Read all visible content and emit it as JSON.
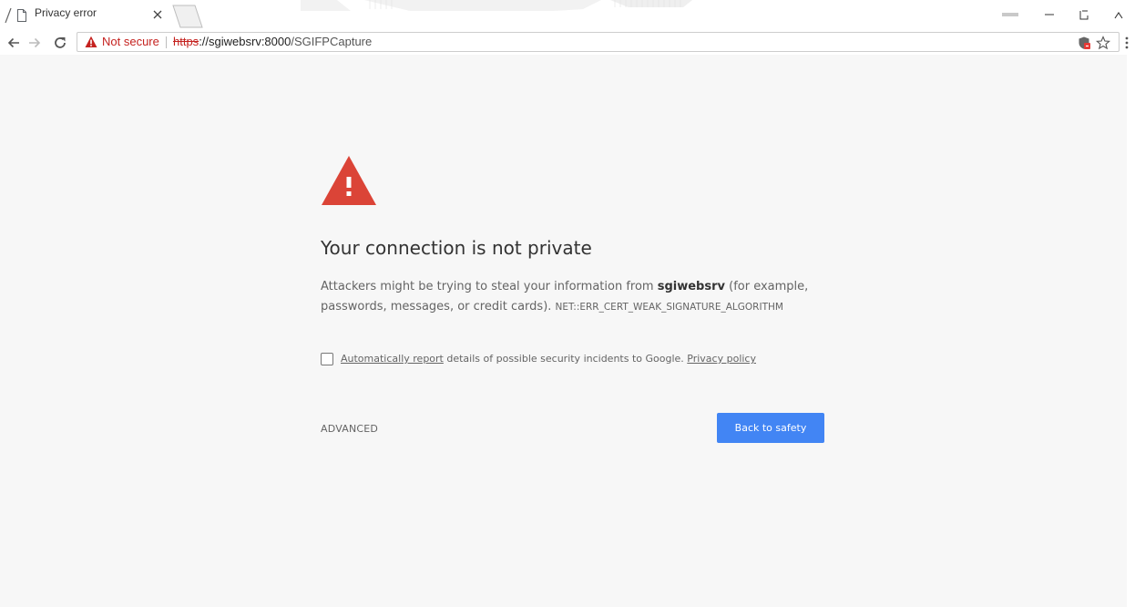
{
  "tab": {
    "title": "Privacy error",
    "icons": {
      "page": "page-icon",
      "close": "close-icon"
    }
  },
  "toolbar": {
    "security_label": "Not secure",
    "url": {
      "scheme": "https",
      "host_port": "://sgiwebsrv:8000",
      "path": "/SGIFPCapture"
    },
    "icons": {
      "back": "arrow-left-icon",
      "forward": "arrow-right-icon",
      "reload": "reload-icon",
      "warning": "warning-triangle-icon",
      "extension": "shield-extension-icon",
      "bookmark": "star-icon",
      "menu": "kebab-menu-icon"
    }
  },
  "window_controls": [
    "minimize-icon",
    "restore-icon",
    "close-icon"
  ],
  "interstitial": {
    "heading": "Your connection is not private",
    "desc_prefix": "Attackers might be trying to steal your information from ",
    "host": "sgiwebsrv",
    "desc_suffix": " (for example, passwords, messages, or credit cards). ",
    "error_code": "NET::ERR_CERT_WEAK_SIGNATURE_ALGORITHM",
    "report_link": "Automatically report",
    "report_text": " details of possible security incidents to Google. ",
    "privacy_link": "Privacy policy",
    "advanced": "ADVANCED",
    "back_button": "Back to safety"
  },
  "colors": {
    "page_background": "#f7f7f7",
    "warning_red": "#db4437",
    "not_secure_red": "#c5221f",
    "primary_button": "#4285f4",
    "body_text": "#646464",
    "heading_text": "#333333"
  }
}
